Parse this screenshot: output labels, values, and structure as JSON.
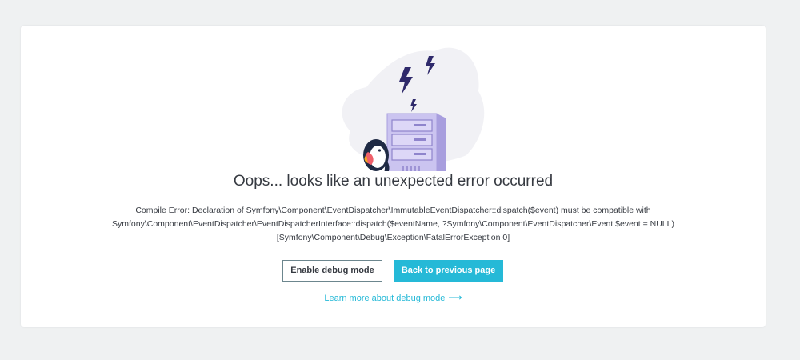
{
  "error_page": {
    "title": "Oops... looks like an unexpected error occurred",
    "message_lines": [
      "Compile Error: Declaration of Symfony\\Component\\EventDispatcher\\ImmutableEventDispatcher::dispatch($event) must be compatible with",
      "Symfony\\Component\\EventDispatcher\\EventDispatcherInterface::dispatch($eventName, ?Symfony\\Component\\EventDispatcher\\Event $event = NULL)",
      "[Symfony\\Component\\Debug\\Exception\\FatalErrorException 0]"
    ],
    "enable_debug_label": "Enable debug mode",
    "back_label": "Back to previous page",
    "learn_more_label": "Learn more about debug mode",
    "learn_more_arrow": "⟶"
  },
  "colors": {
    "background": "#eff1f2",
    "card": "#ffffff",
    "accent": "#25b9d7",
    "text": "#363a41",
    "server": "#c9c1ee",
    "lightning": "#2f2a6b"
  },
  "icons": {
    "illustration": "server-error-illustration",
    "lightning": "lightning-bolt-icon",
    "arrow": "long-right-arrow-icon"
  }
}
